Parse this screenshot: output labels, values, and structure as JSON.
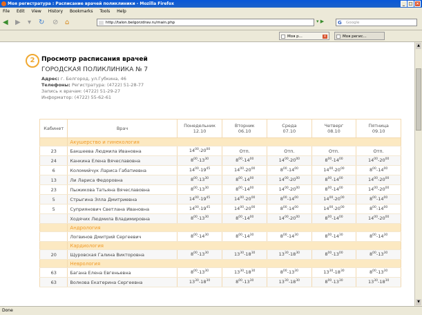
{
  "window": {
    "title": "Моя регистратура : Расписание врачей поликлиники - Mozilla Firefox"
  },
  "menu": [
    "File",
    "Edit",
    "View",
    "History",
    "Bookmarks",
    "Tools",
    "Help"
  ],
  "nav": {
    "url": "http://talon.belgorzdrav.ru/main.php",
    "search_placeholder": "Google"
  },
  "tabs": [
    "Моя р...",
    "Моя регис..."
  ],
  "page": {
    "step": "2",
    "heading": "Просмотр расписания врачей",
    "clinic": "ГОРОДСКАЯ ПОЛИКЛИНИКА № 7",
    "address_label": "Адрес:",
    "address": "г. Белгород, ул.Губкина, 46",
    "phones_label": "Телефоны:",
    "phones": "Регистратура: (4722) 51-28-77",
    "appointment": "Запись к врачам: (4722) 51-29-27",
    "informer": "Информатор: (4722) 55-62-61"
  },
  "table": {
    "headers": {
      "cabinet": "Кабинет",
      "doctor": "Врач",
      "days": [
        {
          "name": "Понедельник",
          "date": "12.10"
        },
        {
          "name": "Вторник",
          "date": "06.10"
        },
        {
          "name": "Среда",
          "date": "07.10"
        },
        {
          "name": "Четверг",
          "date": "08.10"
        },
        {
          "name": "Пятница",
          "date": "09.10"
        }
      ]
    },
    "sections": [
      {
        "category": "Акушерство и гинекология",
        "rows": [
          {
            "cab": "23",
            "doc": "Бакшеева Людмила Ивановна",
            "times": [
              "14:00-20:00",
              "Отп.",
              "Отп.",
              "Отп.",
              "Отп."
            ]
          },
          {
            "cab": "24",
            "doc": "Канкина Елена Вячеславовна",
            "times": [
              "8:00-13:30",
              "8:00-14:00",
              "14:00-20:00",
              "8:00-14:00",
              "14:00-20:00"
            ]
          },
          {
            "cab": "6",
            "doc": "Коломийчук Лариса Габатиевна",
            "times": [
              "14:00-19:45",
              "14:00-20:00",
              "8:00-14:00",
              "14:00-20:00",
              "8:00-14:00"
            ]
          },
          {
            "cab": "13",
            "doc": "Ли Лариса Федоровна",
            "times": [
              "8:00-13:30",
              "8:00-14:00",
              "14:00-20:00",
              "8:00-14:00",
              "14:00-20:00"
            ]
          },
          {
            "cab": "23",
            "doc": "Пыжикова Татьяна Вячеславовна",
            "times": [
              "8:00-13:30",
              "8:00-14:00",
              "14:00-20:00",
              "8:00-14:00",
              "14:00-20:00"
            ]
          },
          {
            "cab": "5",
            "doc": "Стрыгина Элла Дмитриевна",
            "times": [
              "14:00-19:45",
              "14:00-20:00",
              "8:00-14:00",
              "14:00-20:00",
              "8:00-14:00"
            ]
          },
          {
            "cab": "5",
            "doc": "Суприянович Светлана Ивановна",
            "times": [
              "14:00-19:45",
              "14:00-20:00",
              "8:00-14:00",
              "14:00-20:00",
              "8:00-14:00"
            ]
          },
          {
            "cab": "",
            "doc": "Ходячих Людмила Владимировна",
            "times": [
              "8:00-13:30",
              "8:00-14:00",
              "14:00-20:00",
              "8:00-14:00",
              "14:00-20:00"
            ]
          }
        ]
      },
      {
        "category": "Андрология",
        "rows": [
          {
            "cab": "",
            "doc": "Логвинов Дмитрий Сергеевич",
            "times": [
              "8:00-14:30",
              "8:00-14:30",
              "8:00-14:30",
              "8:00-14:30",
              "8:00-14:30"
            ]
          }
        ]
      },
      {
        "category": "Кардиология",
        "rows": [
          {
            "cab": "20",
            "doc": "Щуровская Галина Викторовна",
            "times": [
              "8:00-13:30",
              "13:30-18:30",
              "13:30-18:30",
              "8:00-13:00",
              "8:00-13:30"
            ]
          }
        ]
      },
      {
        "category": "Неврология",
        "rows": [
          {
            "cab": "63",
            "doc": "Багана Елена Евгеньевна",
            "times": [
              "8:00-13:30",
              "13:30-18:30",
              "8:00-13:30",
              "13:30-18:30",
              "8:00-13:30"
            ]
          },
          {
            "cab": "63",
            "doc": "Волкова Екатерина Сергеевна",
            "times": [
              "13:30-18:30",
              "8:00-13:30",
              "13:30-18:30",
              "8:00-13:30",
              "13:30-18:30"
            ]
          }
        ]
      }
    ]
  },
  "status": "Done",
  "colors": {
    "accent": "#f0a830",
    "category_bg": "#fce9c2",
    "category_text": "#f09a26"
  }
}
